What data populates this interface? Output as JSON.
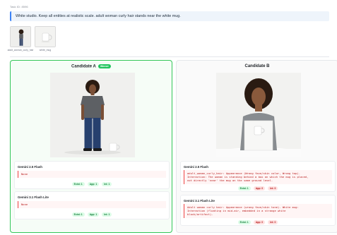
{
  "task_id": "Task ID: 8596",
  "prompt": "White studio. Keep all entities at realistic scale. adult woman curly hair stands near the white mug.",
  "inputs": [
    {
      "caption": "adult_woman_curly_hair",
      "icon": "person-thumbnail"
    },
    {
      "caption": "white_mug",
      "icon": "mug-thumbnail"
    }
  ],
  "candidates": {
    "a": {
      "title": "Candidate A",
      "winner_label": "Winner",
      "evaluations": [
        {
          "model": "Gemini 2.5 Flash",
          "result": "None",
          "badges": [
            "Exist: 1",
            "App: 1",
            "Int: 1"
          ]
        },
        {
          "model": "Gemini 3.1 Flash Lite",
          "result": "None",
          "badges": [
            "Exist: 1",
            "App: 1",
            "Int: 1"
          ]
        }
      ]
    },
    "b": {
      "title": "Candidate B",
      "evaluations": [
        {
          "model": "Gemini 2.5 Flash",
          "result_lines": [
            "adult_woman_curly_hair: Appearance (Wrong face/skin color, Wrong top).",
            "Interaction: The woman is standing behind a box on which the mug is placed,",
            "not directly 'near' the mug on the same ground level."
          ],
          "badges": [
            "Exist: 1",
            "App: 0",
            "Int: 0"
          ]
        },
        {
          "model": "Gemini 3.1 Flash Lite",
          "result_lines": [
            "Adult woman curly hair: Appearance (wrong face/skin tone). White mug:",
            "Interaction (floating in mid-air, embedded in a strange white",
            "block/artifact)."
          ],
          "badges": [
            "Exist: 1",
            "App: 0",
            "Int: 0"
          ]
        }
      ]
    }
  },
  "colors": {
    "winner": "#22c55e",
    "pass": "#15803d",
    "fail": "#b91c1c",
    "prompt_accent": "#3b82f6"
  }
}
